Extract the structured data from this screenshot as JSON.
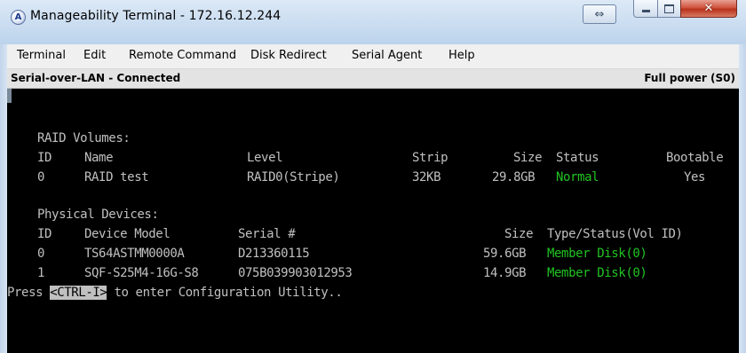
{
  "window": {
    "icon_glyph": "A",
    "title": "Manageability Terminal - 172.16.12.244",
    "buttons": {
      "restore_glyph": "⇔",
      "close_glyph": "✕"
    }
  },
  "menu": {
    "items": [
      "Terminal",
      "Edit",
      "Remote Command",
      "Disk Redirect",
      "Serial Agent",
      "Help"
    ]
  },
  "status": {
    "connection": "Serial-over-LAN - Connected",
    "power": "Full power (S0)"
  },
  "terminal": {
    "raid": {
      "heading": "RAID Volumes:",
      "headers": {
        "id": "ID",
        "name": "Name",
        "level": "Level",
        "strip": "Strip",
        "size": "Size",
        "status": "Status",
        "bootable": "Bootable"
      },
      "rows": [
        {
          "id": "0",
          "name": "RAID test",
          "level": "RAID0(Stripe)",
          "strip": "32KB",
          "size": "29.8GB",
          "status": "Normal",
          "bootable": "Yes"
        }
      ]
    },
    "physical": {
      "heading": "Physical Devices:",
      "headers": {
        "id": "ID",
        "model": "Device Model",
        "serial": "Serial #",
        "size": "Size",
        "type": "Type/Status(Vol ID)"
      },
      "rows": [
        {
          "id": "0",
          "model": "TS64ASTMM0000A",
          "serial": "D213360115",
          "size": "59.6GB",
          "type": "Member Disk(0)"
        },
        {
          "id": "1",
          "model": "SQF-S25M4-16G-S8",
          "serial": "075B039903012953",
          "size": "14.9GB",
          "type": "Member Disk(0)"
        }
      ]
    },
    "prompt": {
      "before": "Press ",
      "key": "<CTRL-I>",
      "after": " to enter Configuration Utility.."
    }
  },
  "colors": {
    "terminal_bg": "#000000",
    "terminal_text": "#c0c0c0",
    "terminal_green": "#22c322",
    "close_button": "#c8412b"
  }
}
